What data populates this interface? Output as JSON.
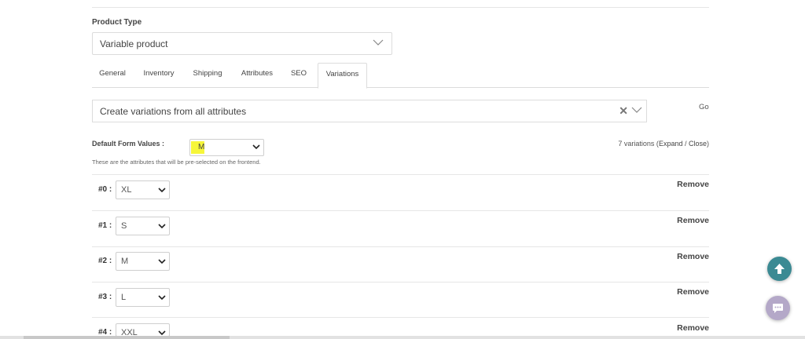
{
  "product_type": {
    "label": "Product Type",
    "selected": "Variable product"
  },
  "tabs": [
    {
      "label": "General"
    },
    {
      "label": "Inventory"
    },
    {
      "label": "Shipping"
    },
    {
      "label": "Attributes"
    },
    {
      "label": "SEO"
    },
    {
      "label": "Variations",
      "active": true
    }
  ],
  "variation_action": {
    "selected": "Create variations from all attributes",
    "go_label": "Go"
  },
  "default_form": {
    "label": "Default Form Values :",
    "selected": "M",
    "help": "These are the attributes that will be pre-selected on the frontend."
  },
  "variations_summary": {
    "count_text": "7 variations (",
    "expand": "Expand",
    "separator": " / ",
    "close": "Close",
    "end": ")"
  },
  "variations": [
    {
      "label": "#0 :",
      "size": "XL",
      "remove": "Remove"
    },
    {
      "label": "#1 :",
      "size": "S",
      "remove": "Remove"
    },
    {
      "label": "#2 :",
      "size": "M",
      "remove": "Remove"
    },
    {
      "label": "#3 :",
      "size": "L",
      "remove": "Remove"
    },
    {
      "label": "#4 :",
      "size": "XXL",
      "remove": "Remove"
    }
  ],
  "icons": {
    "scroll_top": "arrow-up-icon",
    "chat": "chat-bubble-icon"
  },
  "colors": {
    "scroll_top_bg": "#3b8a93",
    "chat_bg": "#b4a8c8",
    "highlight": "#f6f63a"
  }
}
